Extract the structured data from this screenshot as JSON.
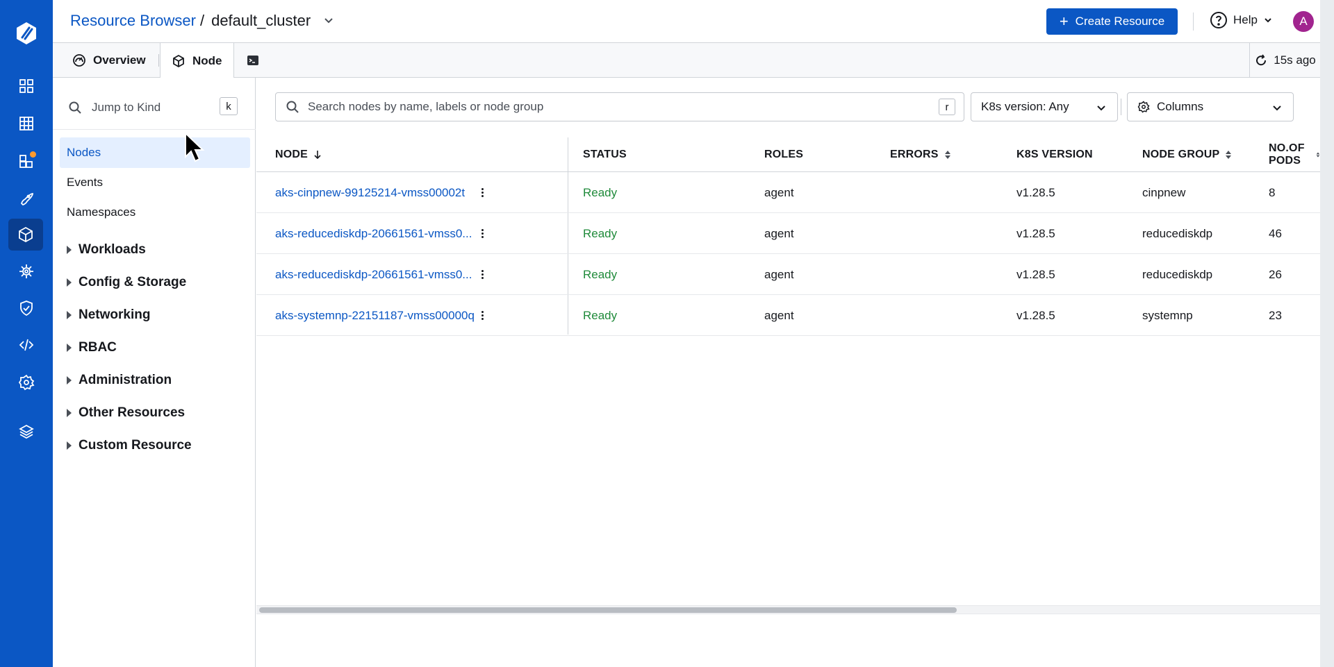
{
  "rail": {
    "logo_icon": "devtron-logo-icon",
    "items": [
      {
        "name": "apps-grid-icon"
      },
      {
        "name": "table-grid-icon"
      },
      {
        "name": "app-groups-icon",
        "badge": true
      },
      {
        "name": "rocket-icon"
      },
      {
        "name": "cube-icon",
        "active": true
      },
      {
        "name": "bug-icon"
      },
      {
        "name": "shield-icon"
      },
      {
        "name": "code-icon"
      },
      {
        "name": "gear-icon"
      },
      {
        "name": "layers-icon"
      }
    ]
  },
  "header": {
    "breadcrumb_root": "Resource Browser",
    "breadcrumb_sep": "/",
    "cluster": "default_cluster",
    "create_label": "Create Resource",
    "help_label": "Help",
    "avatar_initial": "A"
  },
  "tabs": {
    "overview": "Overview",
    "node": "Node",
    "refresh_label": "15s ago"
  },
  "leftnav": {
    "jump_placeholder": "Jump to Kind",
    "jump_shortcut": "k",
    "items": [
      "Nodes",
      "Events",
      "Namespaces"
    ],
    "groups": [
      "Workloads",
      "Config & Storage",
      "Networking",
      "RBAC",
      "Administration",
      "Other Resources",
      "Custom Resource"
    ]
  },
  "toolbar": {
    "search_placeholder": "Search nodes by name, labels or node group",
    "search_shortcut": "r",
    "k8s_filter": "K8s version: Any",
    "columns_label": "Columns"
  },
  "table": {
    "headers": {
      "node": "NODE",
      "status": "STATUS",
      "roles": "ROLES",
      "errors": "ERRORS",
      "k8s_version": "K8S VERSION",
      "node_group": "NODE GROUP",
      "pods": "NO.OF PODS"
    },
    "rows": [
      {
        "node": "aks-cinpnew-99125214-vmss00002t",
        "status": "Ready",
        "roles": "agent",
        "errors": "",
        "k8s_version": "v1.28.5",
        "node_group": "cinpnew",
        "pods": "8"
      },
      {
        "node": "aks-reducediskdp-20661561-vmss0...",
        "status": "Ready",
        "roles": "agent",
        "errors": "",
        "k8s_version": "v1.28.5",
        "node_group": "reducediskdp",
        "pods": "46"
      },
      {
        "node": "aks-reducediskdp-20661561-vmss0...",
        "status": "Ready",
        "roles": "agent",
        "errors": "",
        "k8s_version": "v1.28.5",
        "node_group": "reducediskdp",
        "pods": "26"
      },
      {
        "node": "aks-systemnp-22151187-vmss00000q",
        "status": "Ready",
        "roles": "agent",
        "errors": "",
        "k8s_version": "v1.28.5",
        "node_group": "systemnp",
        "pods": "23"
      }
    ]
  },
  "colors": {
    "brand": "#0b57c4",
    "ready": "#1f8a3a",
    "avatar": "#a1248f"
  }
}
